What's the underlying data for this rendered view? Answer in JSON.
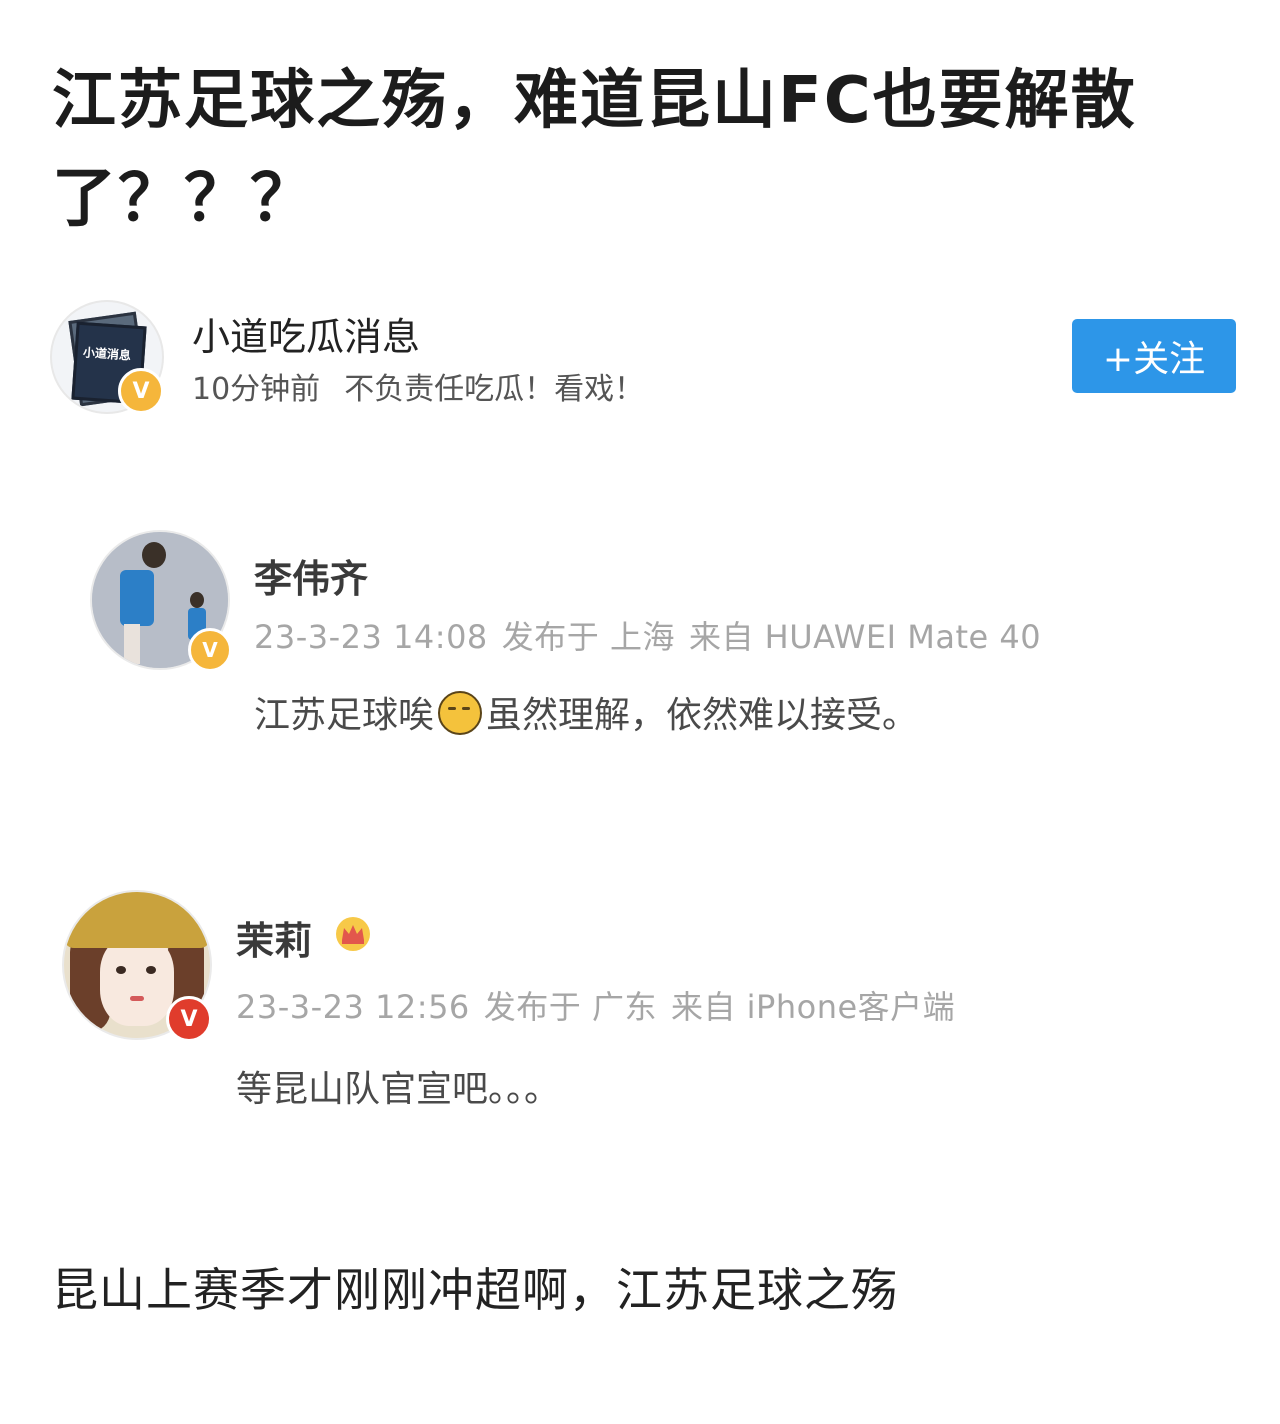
{
  "article": {
    "title": "江苏足球之殇，难道昆山FC也要解散了？？？",
    "body": "昆山上赛季才刚刚冲超啊，江苏足球之殇"
  },
  "author": {
    "name": "小道吃瓜消息",
    "avatar_text": "小道消息",
    "time": "10分钟前",
    "bio": "不负责任吃瓜！看戏！",
    "follow_label": "+关注",
    "badge_color": "#f5b63b"
  },
  "comments": [
    {
      "name": "李伟齐",
      "date": "23-3-23 14:08",
      "location": "发布于 上海",
      "device": "来自 HUAWEI Mate 40",
      "text_before_emoji": "江苏足球唉",
      "emoji": "sad-face-emoji",
      "text_after_emoji": "虽然理解，依然难以接受。",
      "badge_color": "#f5b63b"
    },
    {
      "name": "茉莉",
      "date": "23-3-23 12:56",
      "location": "发布于 广东",
      "device": "来自 iPhone客户端",
      "text": "等昆山队官宣吧。。。",
      "badge_color": "#e03c2c",
      "member_icon": "crown-icon"
    }
  ],
  "colors": {
    "accent": "#2d96e8"
  }
}
